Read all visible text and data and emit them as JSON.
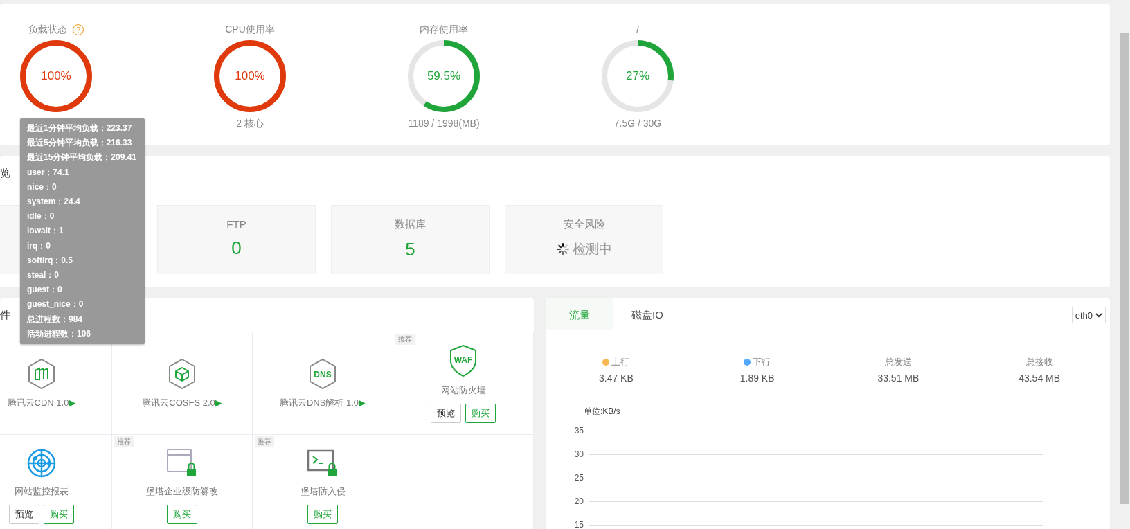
{
  "gauges": [
    {
      "title": "负载状态",
      "help": "?",
      "value": "100%",
      "level": 1,
      "color": "#e03a0c"
    },
    {
      "title": "CPU使用率",
      "value": "100%",
      "level": 1,
      "color": "#e03a0c",
      "subtext": "2 核心"
    },
    {
      "title": "内存使用率",
      "value": "59.5%",
      "level": 0.595,
      "color": "#20a53a",
      "subtext": "1189 / 1998(MB)"
    },
    {
      "title": "/",
      "value": "27%",
      "level": 0.27,
      "color": "#20a53a",
      "subtext": "7.5G / 30G"
    }
  ],
  "load_tooltip": [
    "最近1分钟平均负载：223.37",
    "最近5分钟平均负载：216.33",
    "最近15分钟平均负载：209.41",
    "user：74.1",
    "nice：0",
    "system：24.4",
    "idle：0",
    "iowait：1",
    "irq：0",
    "softirq：0.5",
    "steal：0",
    "guest：0",
    "guest_nice：0",
    "总进程数：984",
    "活动进程数：106"
  ],
  "overview": {
    "title": "览",
    "cards": [
      {
        "title": "FTP",
        "value": "0",
        "kind": "count"
      },
      {
        "title": "数据库",
        "value": "5",
        "kind": "count"
      },
      {
        "title": "安全风险",
        "value": "检测中",
        "kind": "loading"
      }
    ]
  },
  "software": {
    "title": "件",
    "items": [
      {
        "name": "腾讯云CDN 1.0",
        "arrow": "▶",
        "kind": "cdn"
      },
      {
        "name": "腾讯云COSFS 2.0",
        "arrow": "▶",
        "kind": "cosfs"
      },
      {
        "name": "腾讯云DNS解析 1.0",
        "arrow": "▶",
        "kind": "dns",
        "icon_text": "DNS"
      },
      {
        "name": "网站防火墙",
        "badge": "推荐",
        "kind": "waf",
        "icon_text": "WAF",
        "buttons": [
          {
            "label": "预览",
            "kind": "preview"
          },
          {
            "label": "购买",
            "kind": "buy"
          }
        ]
      },
      {
        "name": "网站监控报表",
        "kind": "monitor",
        "buttons": [
          {
            "label": "预览",
            "kind": "preview"
          },
          {
            "label": "购买",
            "kind": "buy"
          }
        ]
      },
      {
        "name": "堡塔企业级防篡改",
        "badge": "推荐",
        "kind": "tamper",
        "buttons": [
          {
            "label": "购买",
            "kind": "buy"
          }
        ]
      },
      {
        "name": "堡塔防入侵",
        "badge": "推荐",
        "kind": "intrusion",
        "buttons": [
          {
            "label": "购买",
            "kind": "buy"
          }
        ]
      }
    ]
  },
  "traffic": {
    "tabs": [
      {
        "label": "流量",
        "selected": true
      },
      {
        "label": "磁盘IO",
        "selected": false
      }
    ],
    "interface_select": "eth0",
    "stats": [
      {
        "label": "上行",
        "value": "3.47 KB",
        "color": "#f7b851"
      },
      {
        "label": "下行",
        "value": "1.89 KB",
        "color": "#52a9ff"
      },
      {
        "label": "总发送",
        "value": "33.51 MB"
      },
      {
        "label": "总接收",
        "value": "43.54 MB"
      }
    ],
    "chart_unit": "单位:KB/s",
    "y_ticks": [
      "35",
      "30",
      "25",
      "20",
      "15"
    ]
  }
}
